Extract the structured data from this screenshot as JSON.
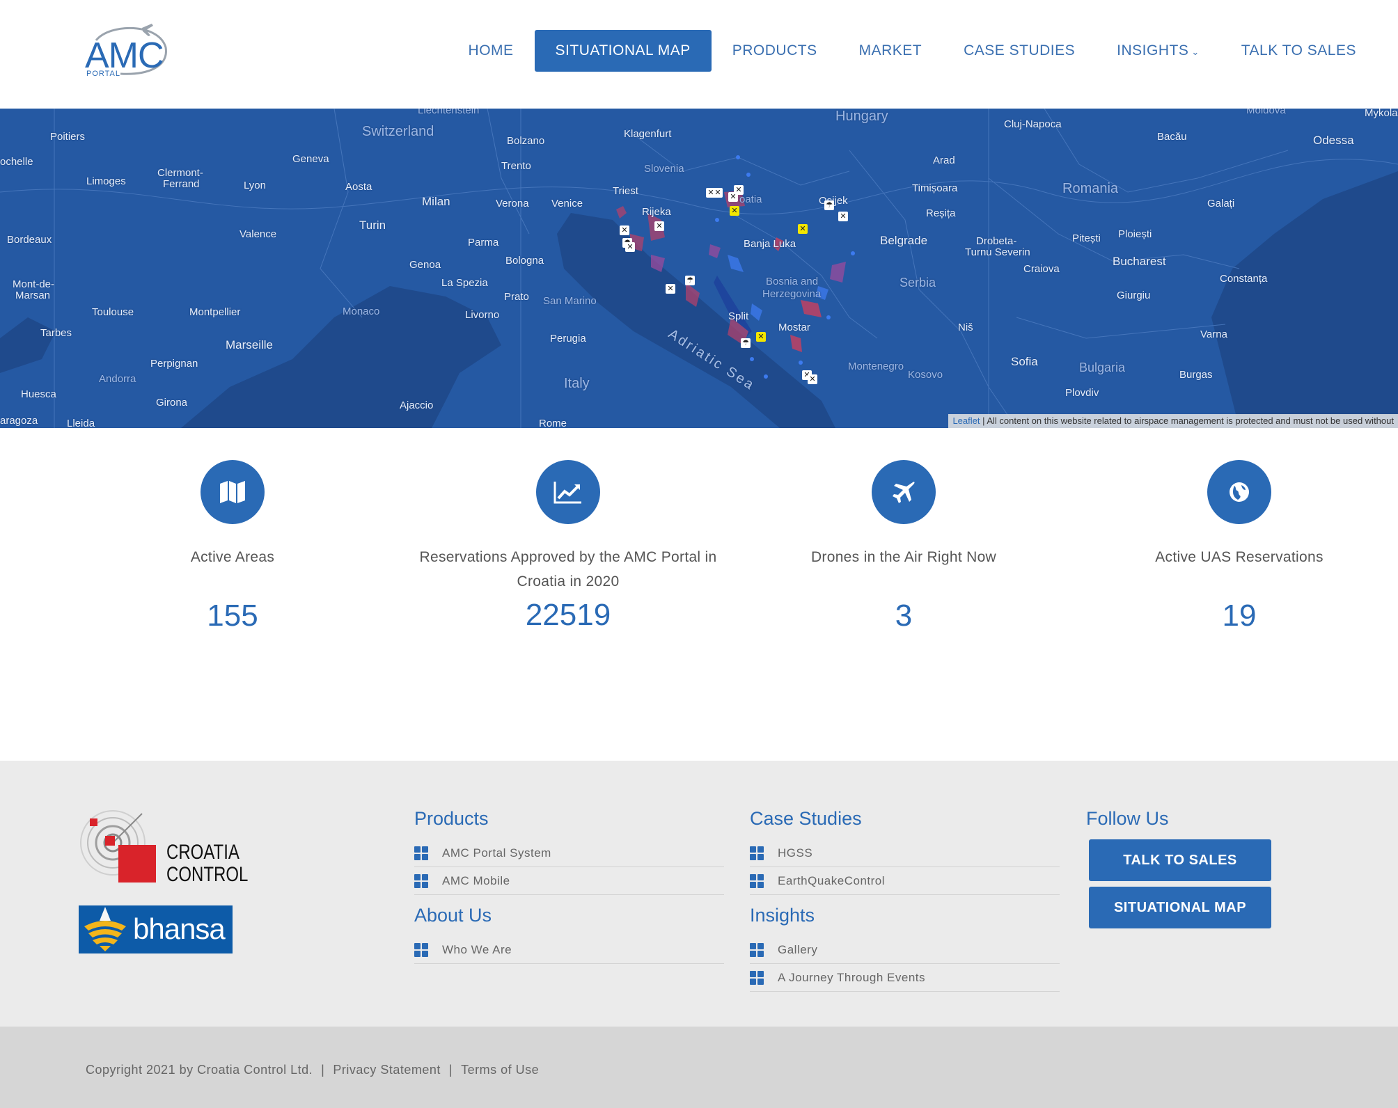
{
  "header": {
    "logo_text": "AMC",
    "logo_sub": "PORTAL",
    "nav": [
      {
        "label": "HOME"
      },
      {
        "label": "SITUATIONAL MAP"
      },
      {
        "label": "PRODUCTS"
      },
      {
        "label": "MARKET"
      },
      {
        "label": "CASE STUDIES"
      },
      {
        "label": "INSIGHTS"
      },
      {
        "label": "TALK TO SALES"
      }
    ],
    "active_nav": "SITUATIONAL MAP"
  },
  "map": {
    "labels": {
      "switzerland": "Switzerland",
      "hungary": "Hungary",
      "romania": "Romania",
      "slovenia": "Slovenia",
      "croatia": "oatia",
      "bosnia": "Bosnia and",
      "herzegovina": "Herzegovina",
      "serbia": "Serbia",
      "bulgaria": "Bulgaria",
      "montenegro": "Montenegro",
      "kosovo": "Kosovo",
      "italy": "Italy",
      "monaco": "Monaco",
      "andorra": "Andorra",
      "san_marino": "San Marino",
      "adriatic": "Adriatic Sea",
      "liechtenstein": "Liechtenstein",
      "moldova": "Moldova",
      "poitiers": "Poitiers",
      "rochelle": "ochelle",
      "limoges": "Limoges",
      "clermont": "Clermont-",
      "ferrand": "Ferrand",
      "geneva": "Geneva",
      "lyon": "Lyon",
      "aosta": "Aosta",
      "bordeaux": "Bordeaux",
      "valence": "Valence",
      "turin": "Turin",
      "milan": "Milan",
      "bolzano": "Bolzano",
      "trento": "Trento",
      "verona": "Verona",
      "venice": "Venice",
      "klagenfurt": "Klagenfurt",
      "triest": "Triest",
      "rijeka": "Rijeka",
      "parma": "Parma",
      "bologna": "Bologna",
      "genoa": "Genoa",
      "la_spezia": "La Spezia",
      "prato": "Prato",
      "livorno": "Livorno",
      "perugia": "Perugia",
      "montpellier": "Montpellier",
      "toulouse": "Toulouse",
      "mont_de": "Mont-de-",
      "marsan": "Marsan",
      "tarbes": "Tarbes",
      "marseille": "Marseille",
      "perpignan": "Perpignan",
      "huesca": "Huesca",
      "girona": "Girona",
      "zaragoza": "aragoza",
      "lleida": "Lleida",
      "ajaccio": "Ajaccio",
      "rome": "Rome",
      "banja_luka": "Banja Luka",
      "split": "Split",
      "mostar": "Mostar",
      "osijek": "Osijek",
      "belgrade": "Belgrade",
      "nis": "Niš",
      "sofia": "Sofia",
      "plovdiv": "Plovdiv",
      "burgas": "Burgas",
      "varna": "Varna",
      "constanta": "Constanța",
      "bucharest": "Bucharest",
      "ploiesti": "Ploiești",
      "pitesti": "Pitești",
      "craiova": "Craiova",
      "giurgiu": "Giurgiu",
      "drobeta": "Drobeta-",
      "turnu": "Turnu Severin",
      "resita": "Reșița",
      "timisoara": "Timișoara",
      "arad": "Arad",
      "cluj": "Cluj-Napoca",
      "bacau": "Bacău",
      "galati": "Galați",
      "odessa": "Odessa",
      "mykola": "Mykola"
    },
    "attribution_link": "Leaflet",
    "attribution_text": " | All content on this website related to airspace management is protected and must not be used without"
  },
  "stats": [
    {
      "icon": "map-icon",
      "label": "Active Areas",
      "value": "155"
    },
    {
      "icon": "chart-line-icon",
      "label": "Reservations Approved by the AMC Portal in Croatia in 2020",
      "value": "22519"
    },
    {
      "icon": "plane-icon",
      "label": "Drones in the Air Right Now",
      "value": "3"
    },
    {
      "icon": "globe-icon",
      "label": "Active UAS Reservations",
      "value": "19"
    }
  ],
  "footer": {
    "croatia_logo_line1": "CROATIA",
    "croatia_logo_line2": "CONTROL",
    "bhansa_logo": "bhansa",
    "products_title": "Products",
    "products": [
      "AMC Portal System",
      "AMC Mobile"
    ],
    "about_title": "About Us",
    "about": [
      "Who We Are"
    ],
    "case_title": "Case Studies",
    "cases": [
      "HGSS",
      "EarthQuakeControl"
    ],
    "insights_title": "Insights",
    "insights": [
      "Gallery",
      "A Journey Through Events"
    ],
    "follow_title": "Follow Us",
    "btn_sales": "TALK TO SALES",
    "btn_map": "SITUATIONAL MAP"
  },
  "bottom": {
    "copyright": "Copyright 2021 by Croatia Control Ltd.",
    "sep": "|",
    "privacy": "Privacy Statement",
    "terms": "Terms of Use"
  },
  "colors": {
    "brand": "#2a6ab5",
    "map_land": "#2559a3",
    "map_sea": "#1f4a8c",
    "footer_bg": "#ebebeb",
    "bottom_bg": "#d6d6d6"
  }
}
